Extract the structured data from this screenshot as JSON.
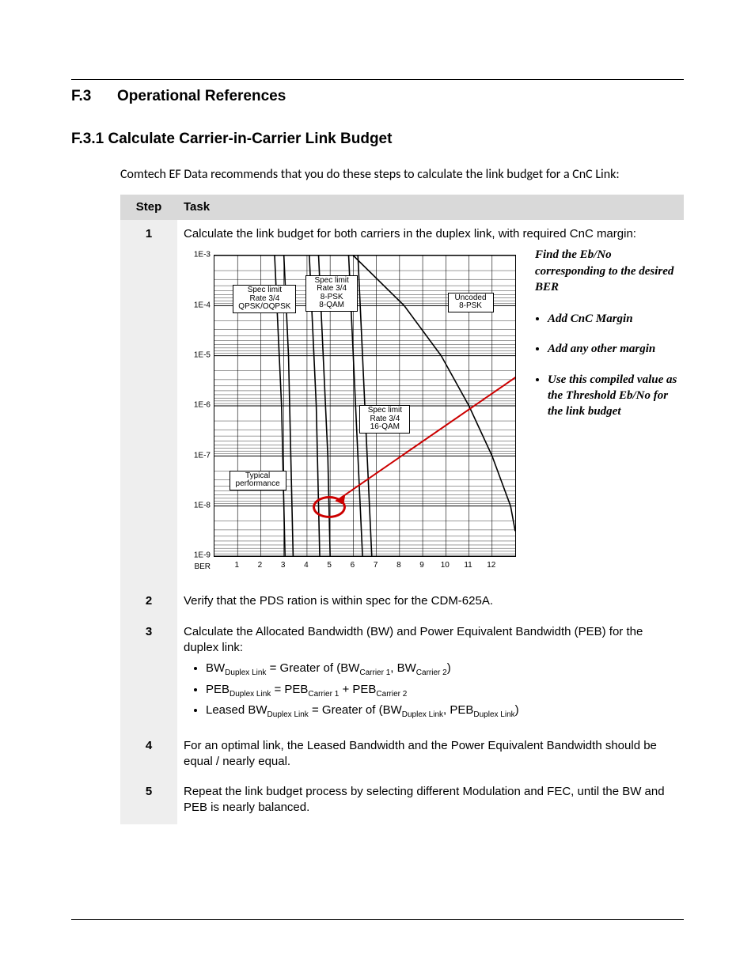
{
  "headings": {
    "h1_num": "F.3",
    "h1_text": "Operational References",
    "h2": "F.3.1  Calculate Carrier-in-Carrier Link Budget"
  },
  "intro": "Comtech EF Data recommends that you do these steps to calculate the link budget for a CnC Link:",
  "table": {
    "col_step": "Step",
    "col_task": "Task"
  },
  "steps": {
    "s1": {
      "n": "1",
      "lead": "Calculate the link budget for both carriers in the duplex link, with required CnC margin:"
    },
    "s2": {
      "n": "2",
      "text": "Verify that the PDS ration is within spec for the CDM-625A."
    },
    "s3": {
      "n": "3",
      "lead": "Calculate the Allocated Bandwidth (BW) and Power Equivalent Bandwidth (PEB) for the duplex link:",
      "li1_a": "BW",
      "li1_b": "Duplex Link",
      "li1_c": " = Greater of (BW",
      "li1_d": "Carrier 1",
      "li1_e": ", BW",
      "li1_f": "Carrier 2",
      "li1_g": ")",
      "li2_a": "PEB",
      "li2_b": "Duplex Link",
      "li2_c": " = PEB",
      "li2_d": "Carrier 1",
      "li2_e": " + PEB",
      "li2_f": "Carrier 2",
      "li3_a": "Leased BW",
      "li3_b": "Duplex Link",
      "li3_c": " = Greater of (BW",
      "li3_d": "Duplex Link",
      "li3_e": ", PEB",
      "li3_f": "Duplex Link",
      "li3_g": ")"
    },
    "s4": {
      "n": "4",
      "text": "For an optimal link, the Leased Bandwidth and the Power Equivalent Bandwidth should be equal / nearly equal."
    },
    "s5": {
      "n": "5",
      "text": "Repeat the link budget process by selecting different Modulation and FEC, until the BW and PEB is nearly balanced."
    }
  },
  "chart_data": {
    "type": "line",
    "ylabel": "BER",
    "ylim_exp": [
      -9,
      -3
    ],
    "xlim": [
      0,
      13
    ],
    "xticks": [
      "1",
      "2",
      "3",
      "4",
      "5",
      "6",
      "7",
      "8",
      "9",
      "10",
      "11",
      "12"
    ],
    "yticks": [
      "1E-3",
      "1E-4",
      "1E-5",
      "1E-6",
      "1E-7",
      "1E-8",
      "1E-9"
    ],
    "annotations": {
      "spec_qpsk": "Spec limit\nRate 3/4\nQPSK/OQPSK",
      "spec_8psk": "Spec limit\nRate 3/4\n8-PSK\n8-QAM",
      "spec_16qam": "Spec limit\nRate 3/4\n16-QAM",
      "uncoded": "Uncoded\n8-PSK",
      "typical": "Typical\nperformance"
    },
    "series": [
      {
        "name": "QPSK/OQPSK spec",
        "points": [
          [
            3.0,
            -3
          ],
          [
            3.1,
            -4
          ],
          [
            3.2,
            -5
          ],
          [
            3.25,
            -6
          ],
          [
            3.3,
            -7
          ],
          [
            3.35,
            -8
          ],
          [
            3.4,
            -9
          ]
        ]
      },
      {
        "name": "QPSK/OQPSK typ",
        "points": [
          [
            2.6,
            -3
          ],
          [
            2.7,
            -4
          ],
          [
            2.8,
            -5
          ],
          [
            2.9,
            -6
          ],
          [
            2.95,
            -7
          ],
          [
            3.0,
            -8
          ],
          [
            3.05,
            -9
          ]
        ]
      },
      {
        "name": "8PSK/8QAM spec",
        "points": [
          [
            4.5,
            -3
          ],
          [
            4.6,
            -4
          ],
          [
            4.7,
            -5
          ],
          [
            4.8,
            -6
          ],
          [
            4.9,
            -7
          ],
          [
            4.95,
            -8
          ],
          [
            5.0,
            -9
          ]
        ]
      },
      {
        "name": "8PSK/8QAM typ",
        "points": [
          [
            4.1,
            -3
          ],
          [
            4.2,
            -4
          ],
          [
            4.3,
            -5
          ],
          [
            4.4,
            -6
          ],
          [
            4.45,
            -7
          ],
          [
            4.5,
            -8
          ],
          [
            4.55,
            -9
          ]
        ]
      },
      {
        "name": "16QAM spec",
        "points": [
          [
            6.2,
            -3
          ],
          [
            6.3,
            -4
          ],
          [
            6.4,
            -5
          ],
          [
            6.5,
            -6
          ],
          [
            6.6,
            -7
          ],
          [
            6.7,
            -8
          ],
          [
            6.8,
            -9
          ]
        ]
      },
      {
        "name": "16QAM typ",
        "points": [
          [
            5.8,
            -3
          ],
          [
            5.9,
            -4
          ],
          [
            6.0,
            -5
          ],
          [
            6.1,
            -6
          ],
          [
            6.2,
            -7
          ],
          [
            6.3,
            -8
          ],
          [
            6.4,
            -9
          ]
        ]
      },
      {
        "name": "Uncoded 8-PSK",
        "points": [
          [
            6.0,
            -3
          ],
          [
            8.2,
            -4
          ],
          [
            9.8,
            -5
          ],
          [
            11.0,
            -6
          ],
          [
            12.0,
            -7
          ],
          [
            12.8,
            -8
          ],
          [
            13.0,
            -8.5
          ]
        ]
      }
    ],
    "highlight_ring": {
      "x": 4.9,
      "y": -8
    }
  },
  "side": {
    "lead": "Find the Eb/No corresponding to the desired BER",
    "b1": "Add CnC Margin",
    "b2": "Add any other margin",
    "b3": "Use this compiled value as the Threshold Eb/No for the link budget"
  }
}
